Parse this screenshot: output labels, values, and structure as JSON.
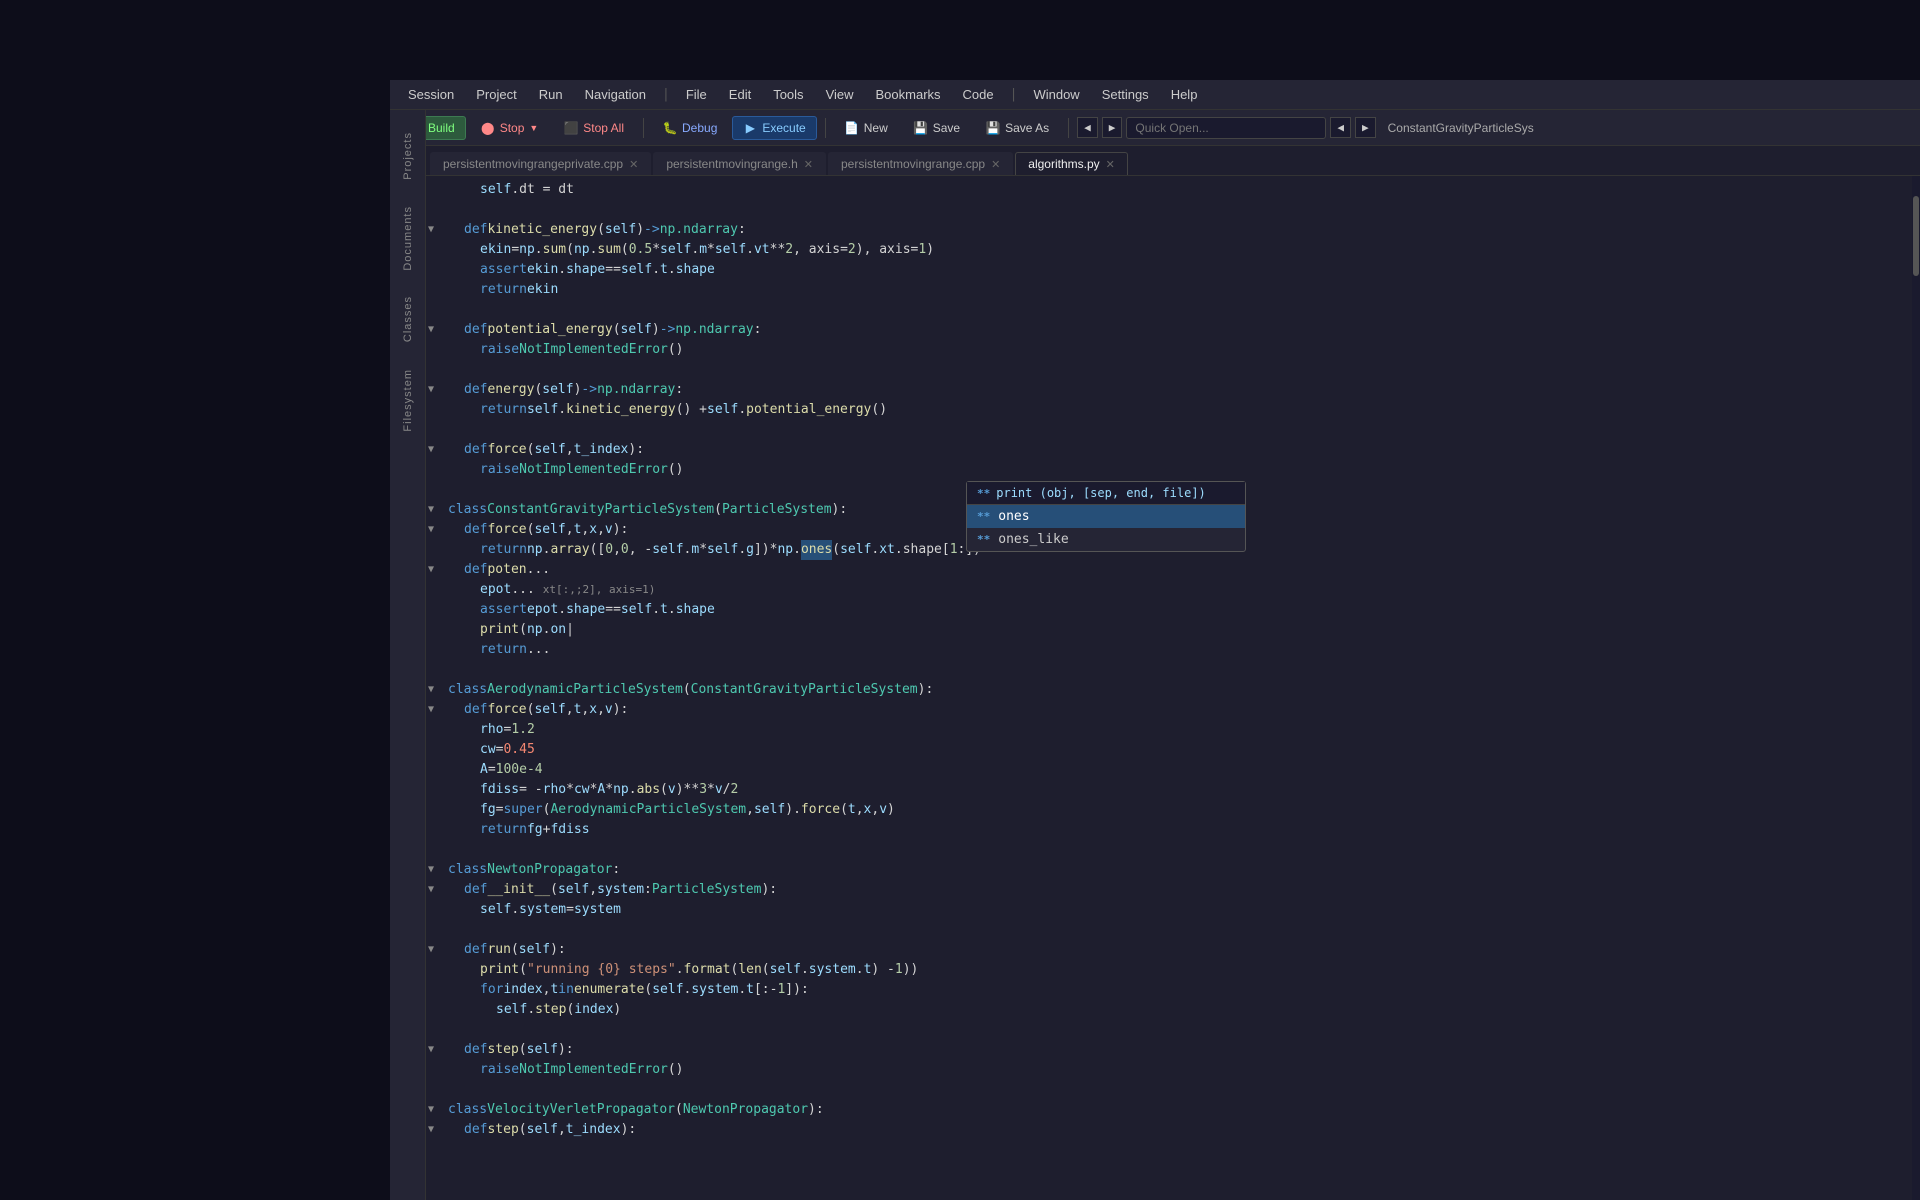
{
  "background": {
    "color": "#0d0d1a"
  },
  "menubar": {
    "items": [
      {
        "label": "Session",
        "id": "session"
      },
      {
        "label": "Project",
        "id": "project"
      },
      {
        "label": "Run",
        "id": "run"
      },
      {
        "label": "Navigation",
        "id": "navigation"
      },
      {
        "label": "|",
        "id": "sep1"
      },
      {
        "label": "File",
        "id": "file"
      },
      {
        "label": "Edit",
        "id": "edit"
      },
      {
        "label": "Tools",
        "id": "tools"
      },
      {
        "label": "View",
        "id": "view"
      },
      {
        "label": "Bookmarks",
        "id": "bookmarks"
      },
      {
        "label": "Code",
        "id": "code"
      },
      {
        "label": "|",
        "id": "sep2"
      },
      {
        "label": "Window",
        "id": "window"
      },
      {
        "label": "Settings",
        "id": "settings"
      },
      {
        "label": "Help",
        "id": "help"
      }
    ]
  },
  "toolbar": {
    "build_label": "Build",
    "stop_label": "Stop",
    "stop_all_label": "Stop All",
    "debug_label": "Debug",
    "execute_label": "Execute",
    "new_label": "New",
    "save_label": "Save",
    "save_as_label": "Save As",
    "quick_open_placeholder": "Quick Open...",
    "class_display": "ConstantGravityParticleSys"
  },
  "side_panels": [
    {
      "label": "Projects",
      "id": "projects"
    },
    {
      "label": "Documents",
      "id": "documents"
    },
    {
      "label": "Classes",
      "id": "classes"
    },
    {
      "label": "Filesystem",
      "id": "filesystem"
    }
  ],
  "tabs": [
    {
      "label": "persistentmovingrangeprivate.cpp",
      "active": false,
      "id": "tab1"
    },
    {
      "label": "persistentmovingrange.h",
      "active": false,
      "id": "tab2"
    },
    {
      "label": "persistentmovingrange.cpp",
      "active": false,
      "id": "tab3"
    },
    {
      "label": "algorithms.py",
      "active": true,
      "id": "tab4"
    }
  ],
  "code": {
    "lines": [
      {
        "indent": 2,
        "content": "self.dt = dt"
      },
      {
        "indent": 0,
        "content": ""
      },
      {
        "indent": 1,
        "content": "def kinetic_energy(self) -> np.ndarray:"
      },
      {
        "indent": 2,
        "content": "ekin = np.sum(np.sum(0.5 * self.m * self.vt**2, axis=2), axis=1)"
      },
      {
        "indent": 2,
        "content": "assert ekin.shape == self.t.shape"
      },
      {
        "indent": 2,
        "content": "return ekin"
      },
      {
        "indent": 0,
        "content": ""
      },
      {
        "indent": 1,
        "content": "def potential_energy(self) -> np.ndarray:"
      },
      {
        "indent": 2,
        "content": "raise NotImplementedError()"
      },
      {
        "indent": 0,
        "content": ""
      },
      {
        "indent": 1,
        "content": "def energy(self) -> np.ndarray:"
      },
      {
        "indent": 2,
        "content": "return self.kinetic_energy() + self.potential_energy()"
      },
      {
        "indent": 0,
        "content": ""
      },
      {
        "indent": 1,
        "content": "def force(self, t_index):"
      },
      {
        "indent": 2,
        "content": "raise NotImplementedError()"
      },
      {
        "indent": 0,
        "content": ""
      },
      {
        "indent": 0,
        "content": "class ConstantGravityParticleSystem(ParticleSystem):"
      },
      {
        "indent": 1,
        "content": "def force(self, t, x, v):"
      },
      {
        "indent": 2,
        "content": "return np.array([0, 0, -self.m * self.g])*np.ones(self.xt.shape[1:])"
      }
    ]
  },
  "autocomplete": {
    "header": {
      "icon": "**",
      "text": "print (obj, [sep, end, file])"
    },
    "items": [
      {
        "icon": "**",
        "label": "ones",
        "selected": true
      },
      {
        "icon": "**",
        "label": "ones_like",
        "selected": false
      }
    ]
  }
}
